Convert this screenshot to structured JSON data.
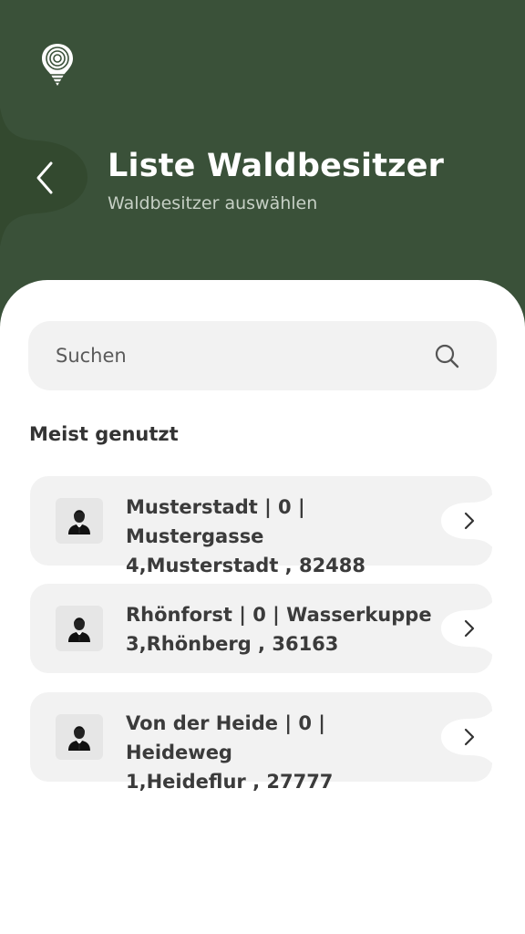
{
  "header": {
    "title": "Liste Waldbesitzer",
    "subtitle": "Waldbesitzer auswählen",
    "logo_icon": "tree-ring-location-pin",
    "back_icon": "chevron-left-icon"
  },
  "search": {
    "placeholder": "Suchen",
    "value": "",
    "icon": "search-icon"
  },
  "section": {
    "title": "Meist genutzt"
  },
  "owners": [
    {
      "line1": "Musterstadt | 0 | Mustergasse",
      "line2": "4,Musterstadt , 82488"
    },
    {
      "line1": "Rhönforst | 0 | Wasserkuppe",
      "line2": "3,Rhönberg , 36163"
    },
    {
      "line1": "Von der Heide | 0 | Heideweg",
      "line2": "1,Heideflur , 27777"
    }
  ],
  "colors": {
    "brand_green": "#3a5139",
    "card_bg": "#f2f2f2",
    "text_dark": "#3b3b3b"
  }
}
